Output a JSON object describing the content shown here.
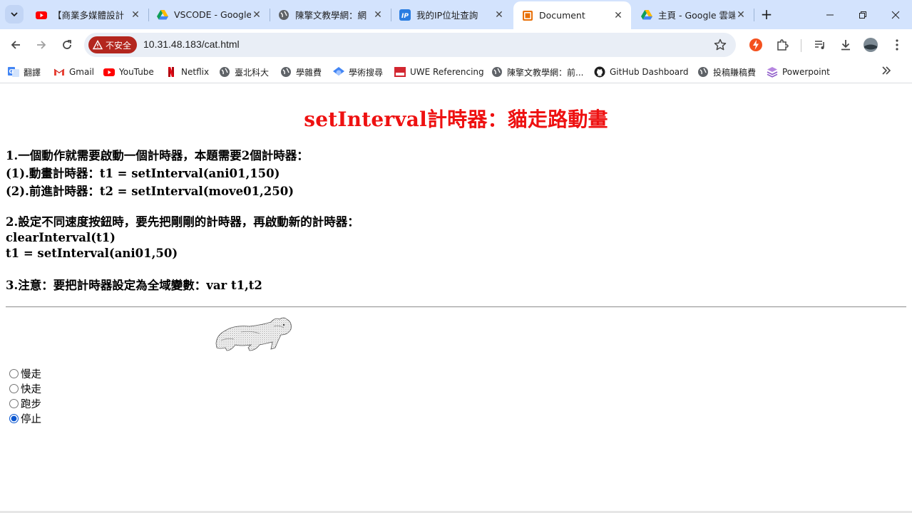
{
  "browser": {
    "tabs": [
      {
        "title": "【商業多媒體設計",
        "icon": "youtube-icon"
      },
      {
        "title": "VSCODE - Google",
        "icon": "google-drive-icon"
      },
      {
        "title": "陳擎文教學網：網",
        "icon": "globe-icon"
      },
      {
        "title": "我的IP位址查詢",
        "icon": "ip-icon"
      },
      {
        "title": "Document",
        "icon": "html-icon",
        "active": true
      },
      {
        "title": "主頁 - Google 雲端",
        "icon": "google-drive-icon"
      }
    ],
    "new_tab": "+",
    "security_label": "不安全",
    "url": "10.31.48.183/cat.html"
  },
  "bookmarks": [
    {
      "label": "翻譯",
      "icon": "translate-icon"
    },
    {
      "label": "Gmail",
      "icon": "gmail-icon"
    },
    {
      "label": "YouTube",
      "icon": "youtube-icon"
    },
    {
      "label": "Netflix",
      "icon": "netflix-icon"
    },
    {
      "label": "臺北科大",
      "icon": "globe-icon"
    },
    {
      "label": "學雜費",
      "icon": "globe-icon"
    },
    {
      "label": "學術搜尋",
      "icon": "scholar-icon"
    },
    {
      "label": "UWE Referencing",
      "icon": "uwe-icon"
    },
    {
      "label": "陳擎文教學網：前...",
      "icon": "globe-icon"
    },
    {
      "label": "GitHub Dashboard",
      "icon": "github-icon"
    },
    {
      "label": "投稿賺稿費",
      "icon": "globe-icon"
    },
    {
      "label": "Powerpoint",
      "icon": "powerpoint-icon"
    }
  ],
  "page": {
    "title": "setInterval計時器：貓走路動畫",
    "section1": [
      "1.一個動作就需要啟動一個計時器，本題需要2個計時器：",
      "(1).動畫計時器：t1 = setInterval(ani01,150)",
      "(2).前進計時器：t2 = setInterval(move01,250)"
    ],
    "section2": [
      "2.設定不同速度按鈕時，要先把剛剛的計時器，再啟動新的計時器：",
      "clearInterval(t1)",
      "t1 = setInterval(ani01,50)"
    ],
    "section3": "3.注意：要把計時器設定為全域變數：var t1,t2",
    "speed_options": [
      {
        "label": "慢走",
        "checked": false
      },
      {
        "label": "快走",
        "checked": false
      },
      {
        "label": "跑步",
        "checked": false
      },
      {
        "label": "停止",
        "checked": true
      }
    ]
  },
  "colors": {
    "title": "#ee1111",
    "tabstrip": "#d3e3fd",
    "insecure_chip": "#b3261e"
  }
}
